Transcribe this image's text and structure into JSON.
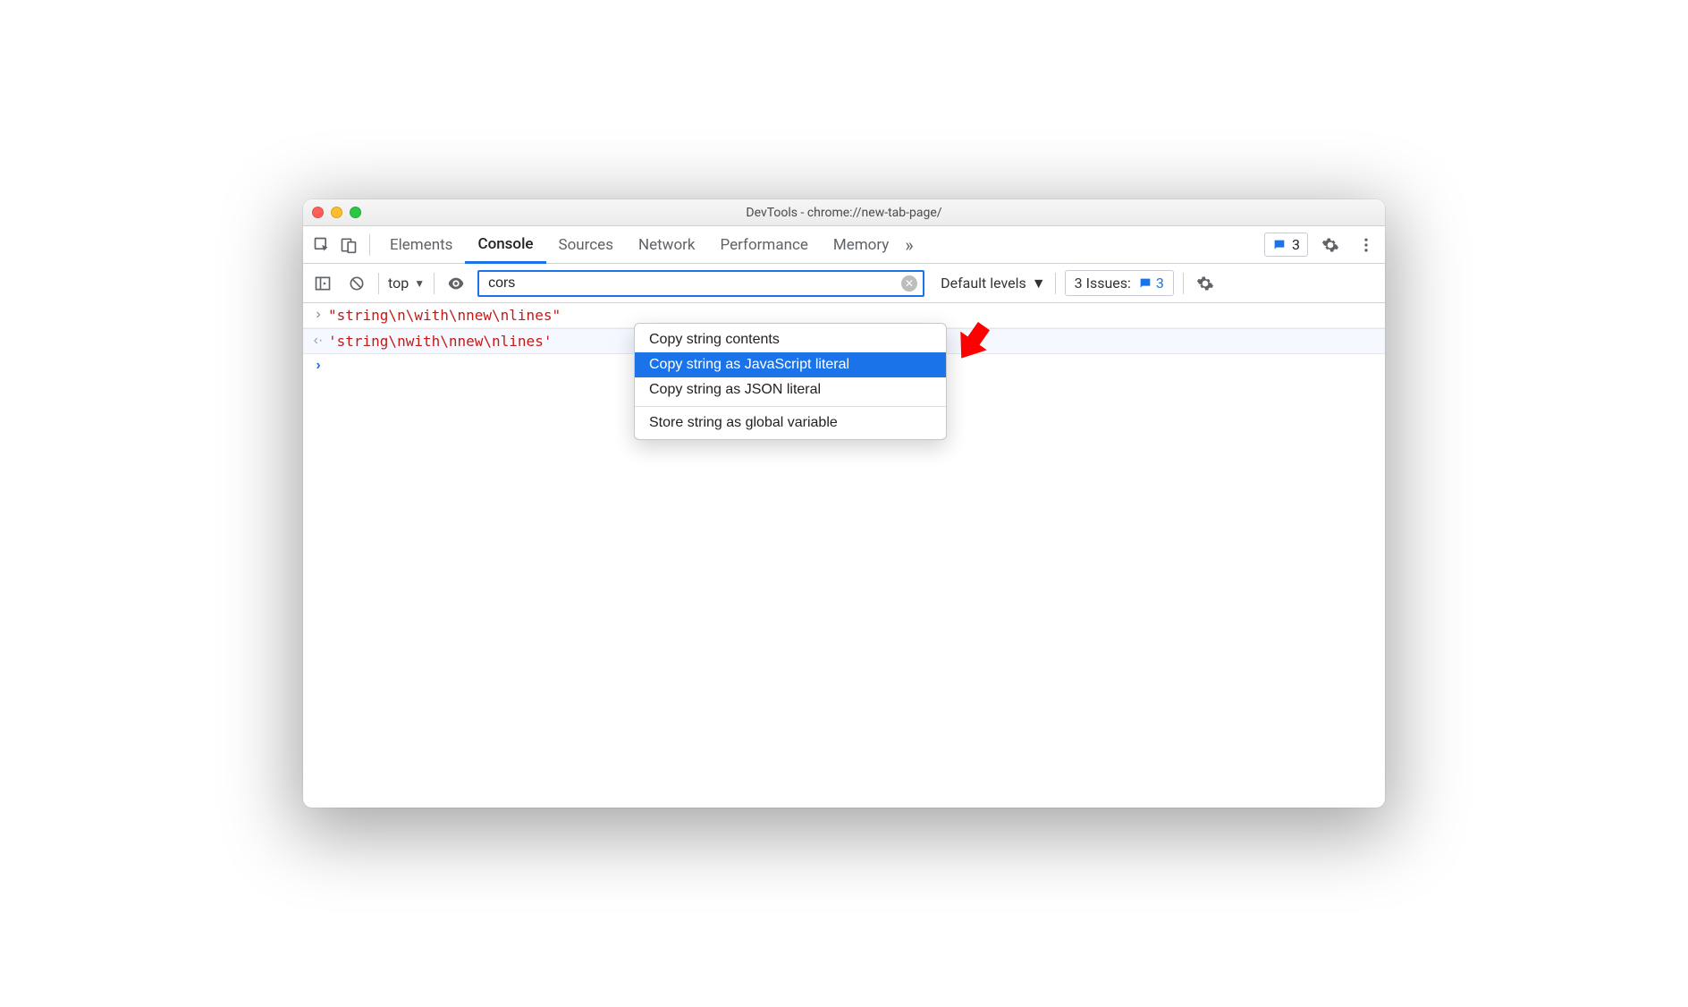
{
  "window": {
    "title": "DevTools - chrome://new-tab-page/"
  },
  "tabs": {
    "items": [
      "Elements",
      "Console",
      "Sources",
      "Network",
      "Performance",
      "Memory"
    ],
    "activeIndex": 1,
    "more": "»",
    "chip_count": "3"
  },
  "filter": {
    "context": "top",
    "value": "cors",
    "levels_label": "Default levels",
    "issues_label": "3 Issues:",
    "issues_count": "3"
  },
  "console": {
    "input_line": "\"string\\n\\with\\nnew\\nlines\"",
    "result_line": "'string\\nwith\\nnew\\nlines'"
  },
  "menu": {
    "items": [
      "Copy string contents",
      "Copy string as JavaScript literal",
      "Copy string as JSON literal"
    ],
    "items2": [
      "Store string as global variable"
    ],
    "highlightIndex": 1
  }
}
